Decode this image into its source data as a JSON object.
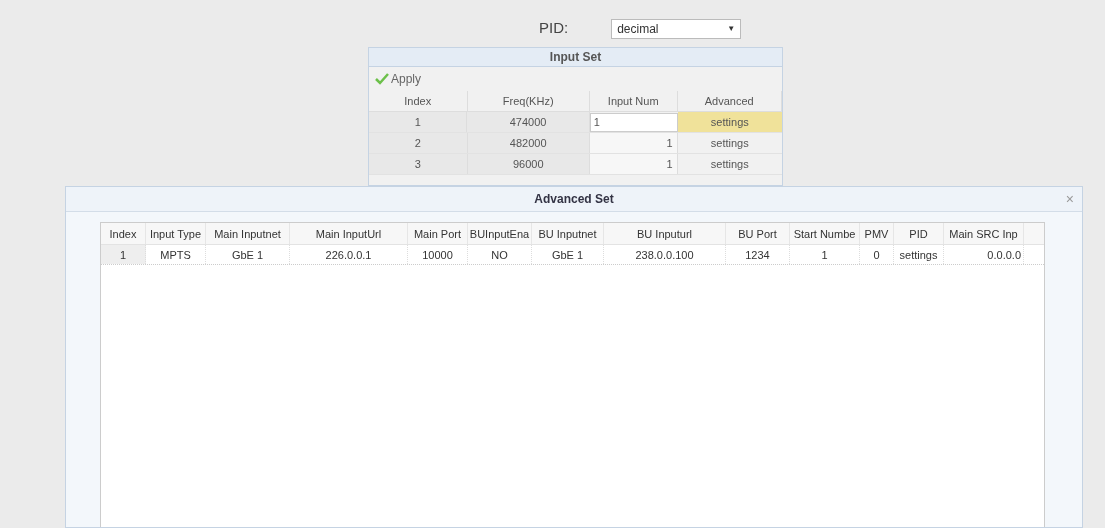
{
  "pid_field": {
    "label": "PID:",
    "value": "decimal",
    "arrow": "▼"
  },
  "input_set": {
    "title": "Input Set",
    "apply": "Apply",
    "columns": [
      "Index",
      "Freq(KHz)",
      "Input Num",
      "Advanced"
    ],
    "rows": [
      {
        "index": "1",
        "freq": "474000",
        "input_num": "1",
        "advanced": "settings",
        "editing": true,
        "selected": true
      },
      {
        "index": "2",
        "freq": "482000",
        "input_num": "1",
        "advanced": "settings",
        "editing": false,
        "selected": false
      },
      {
        "index": "3",
        "freq": "96000",
        "input_num": "1",
        "advanced": "settings",
        "editing": false,
        "selected": false
      }
    ]
  },
  "dialog": {
    "title": "Advanced Set",
    "close": "×",
    "columns": [
      "Index",
      "Input Type",
      "Main Inputnet",
      "Main InputUrl",
      "Main Port",
      "BUInputEna",
      "BU Inputnet",
      "BU Inputurl",
      "BU Port",
      "Start Numbe",
      "PMV",
      "PID",
      "Main SRC Inp"
    ],
    "rows": [
      [
        "1",
        "MPTS",
        "GbE 1",
        "226.0.0.1",
        "10000",
        "NO",
        "GbE 1",
        "238.0.0.100",
        "1234",
        "1",
        "0",
        "settings",
        "0.0.0.0"
      ]
    ]
  }
}
